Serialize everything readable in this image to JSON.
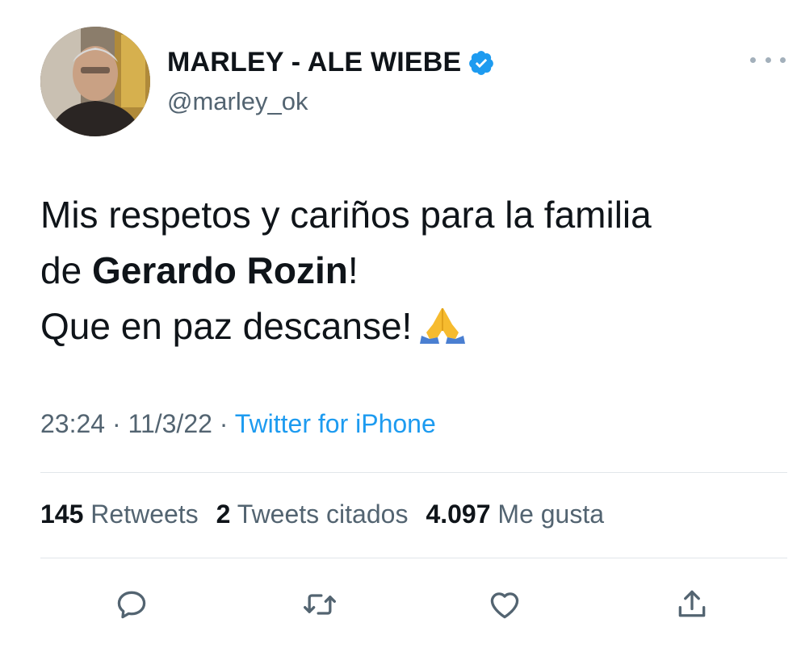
{
  "tweet": {
    "author": {
      "name": "MARLEY - ALE WIEBE",
      "handle": "@marley_ok",
      "verified": true
    },
    "text": {
      "line1": "Mis respetos y cariños para la familia",
      "line2_prefix": "de ",
      "line2_bold": "Gerardo Rozin",
      "line2_suffix": "!",
      "line3": "Que en paz descanse!",
      "emoji": "folded-hands"
    },
    "meta": {
      "time": "23:24",
      "separator1": " · ",
      "date": "11/3/22",
      "separator2": " · ",
      "source": "Twitter for iPhone"
    },
    "stats": [
      {
        "count": "145",
        "label": "Retweets"
      },
      {
        "count": "2",
        "label": "Tweets citados"
      },
      {
        "count": "4.097",
        "label": "Me gusta"
      }
    ],
    "actions": [
      {
        "name": "reply",
        "icon": "speech-bubble-icon"
      },
      {
        "name": "retweet",
        "icon": "retweet-arrows-icon"
      },
      {
        "name": "like",
        "icon": "heart-icon"
      },
      {
        "name": "share",
        "icon": "share-upload-icon"
      }
    ]
  },
  "colors": {
    "text_primary": "#0f1419",
    "text_secondary": "#536471",
    "link": "#1d9bf0",
    "verified": "#1d9bf0",
    "divider": "#e1e6ea"
  }
}
